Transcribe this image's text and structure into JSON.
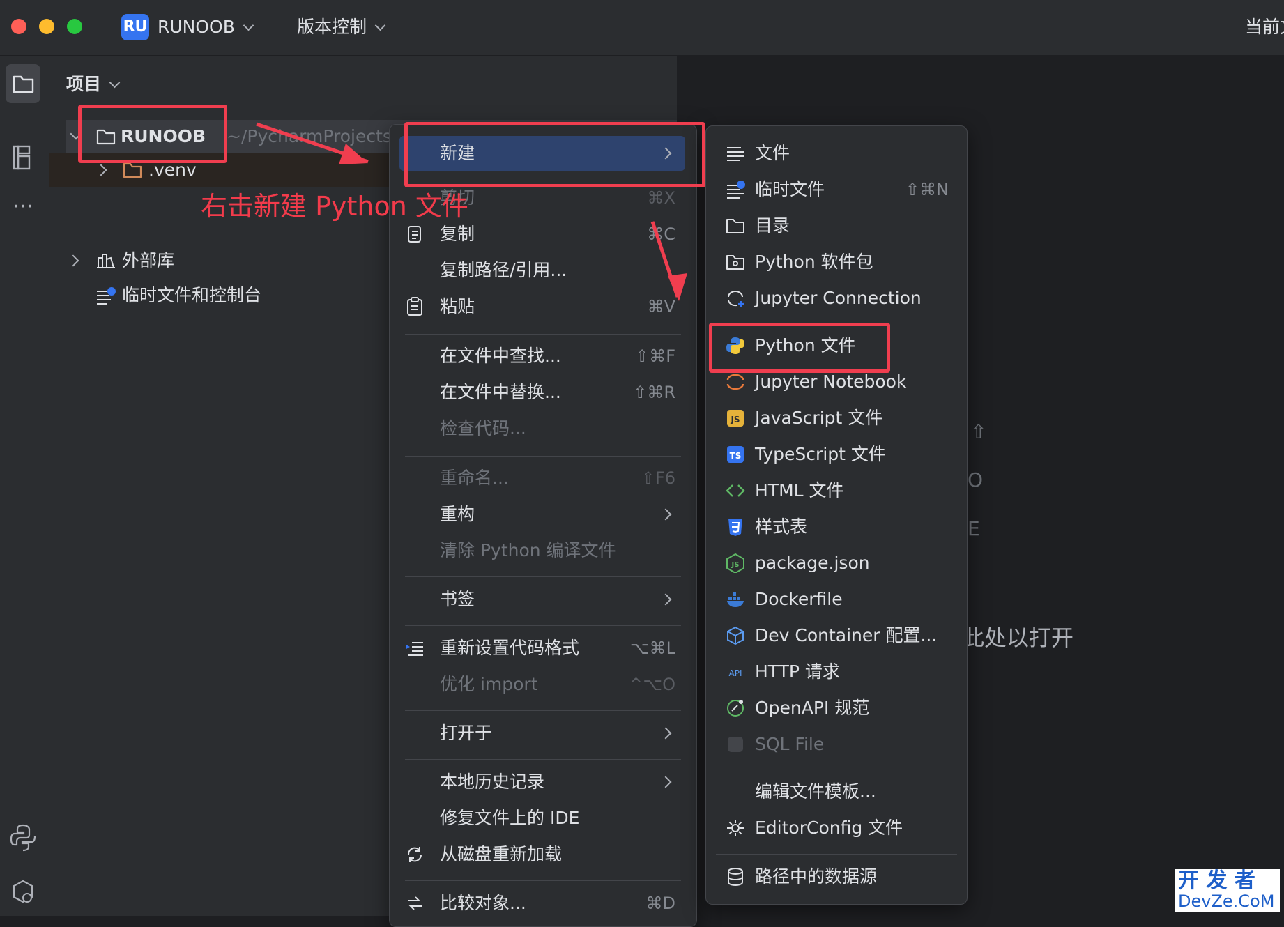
{
  "titlebar": {
    "project_badge": "RU",
    "project_name": "RUNOOB",
    "vcs_label": "版本控制",
    "right_text": "当前文"
  },
  "panel": {
    "title": "项目",
    "tree": {
      "root_name": "RUNOOB",
      "root_path": "~/PycharmProjects/RU",
      "venv": ".venv",
      "external_libs": "外部库",
      "scratches": "临时文件和控制台"
    }
  },
  "annotation": "右击新建 Python 文件",
  "context_menu": {
    "new": "新建",
    "cut": "剪切",
    "cut_sc": "⌘X",
    "copy": "复制",
    "copy_sc": "⌘C",
    "copy_path": "复制路径/引用...",
    "paste": "粘贴",
    "paste_sc": "⌘V",
    "find_in_files": "在文件中查找...",
    "find_sc": "⇧⌘F",
    "replace_in_files": "在文件中替换...",
    "replace_sc": "⇧⌘R",
    "inspect": "检查代码...",
    "rename": "重命名...",
    "rename_sc": "⇧F6",
    "refactor": "重构",
    "clean_python": "清除 Python 编译文件",
    "bookmarks": "书签",
    "reformat": "重新设置代码格式",
    "reformat_sc": "⌥⌘L",
    "optimize_imports": "优化 import",
    "optimize_sc": "^⌥O",
    "open_in": "打开于",
    "local_history": "本地历史记录",
    "repair_ide": "修复文件上的 IDE",
    "reload_disk": "从磁盘重新加载",
    "compare_with": "比较对象...",
    "compare_sc": "⌘D"
  },
  "submenu": {
    "file": "文件",
    "scratch": "临时文件",
    "scratch_sc": "⇧⌘N",
    "directory": "目录",
    "python_package": "Python 软件包",
    "jupyter_connection": "Jupyter Connection",
    "python_file": "Python 文件",
    "jupyter_notebook": "Jupyter Notebook",
    "javascript_file": "JavaScript 文件",
    "typescript_file": "TypeScript 文件",
    "html_file": "HTML 文件",
    "stylesheet": "样式表",
    "package_json": "package.json",
    "dockerfile": "Dockerfile",
    "dev_container": "Dev Container 配置...",
    "http_request": "HTTP 请求",
    "openapi": "OpenAPI 规范",
    "sql_file": "SQL File",
    "edit_templates": "编辑文件模板...",
    "editorconfig": "EditorConfig 文件",
    "data_source": "路径中的数据源"
  },
  "editor_hint": "此处以打开",
  "watermark": {
    "line1": "开 发 者",
    "line2": "DevZe.CoM"
  },
  "colors": {
    "accent": "#3574f0",
    "annotation_red": "#f03e4f",
    "menu_bg": "#2b2d30",
    "selection": "#2e436e"
  }
}
